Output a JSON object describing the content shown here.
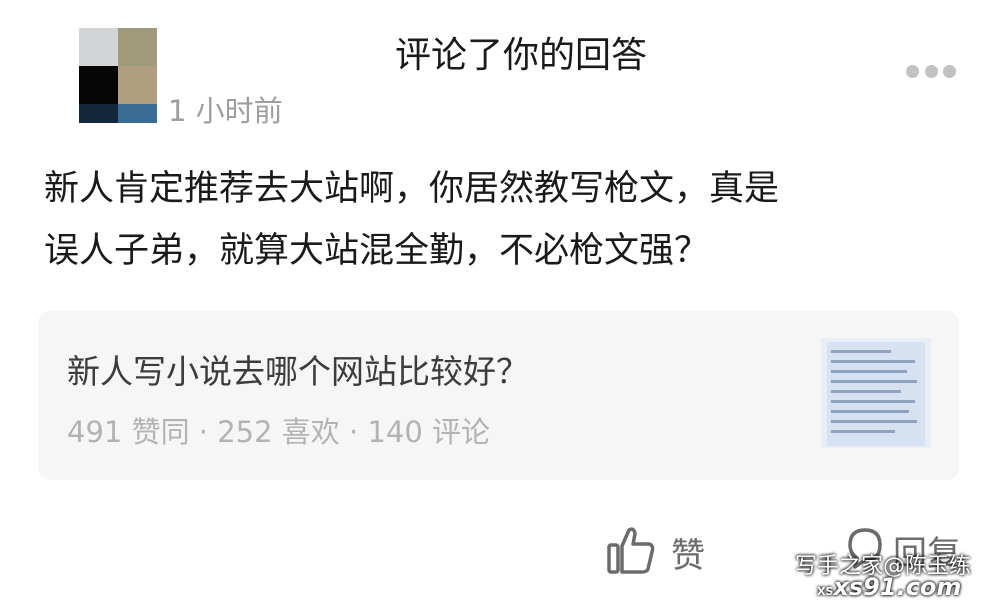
{
  "header": {
    "title": "评论了你的回答",
    "timestamp": "1 小时前",
    "more_icon": "more-dots-icon"
  },
  "comment": {
    "line1": "新人肯定推荐去大站啊，你居然教写枪文，真是",
    "line2": "误人子弟，就算大站混全勤，不必枪文强？"
  },
  "card": {
    "title": "新人写小说去哪个网站比较好？",
    "stats": "491 赞同 · 252 喜欢 · 140 评论",
    "thumbnail_icon": "text-screenshot-thumbnail"
  },
  "actions": {
    "like_label": "赞",
    "reply_label": "回复"
  },
  "watermark": {
    "line1": "写手之家@陈玉练",
    "prefix": "XS",
    "line2": "xs91.com"
  },
  "colors": {
    "text_primary": "#1a1a1a",
    "text_secondary": "#9e9e9e",
    "card_background": "#f6f6f6"
  }
}
